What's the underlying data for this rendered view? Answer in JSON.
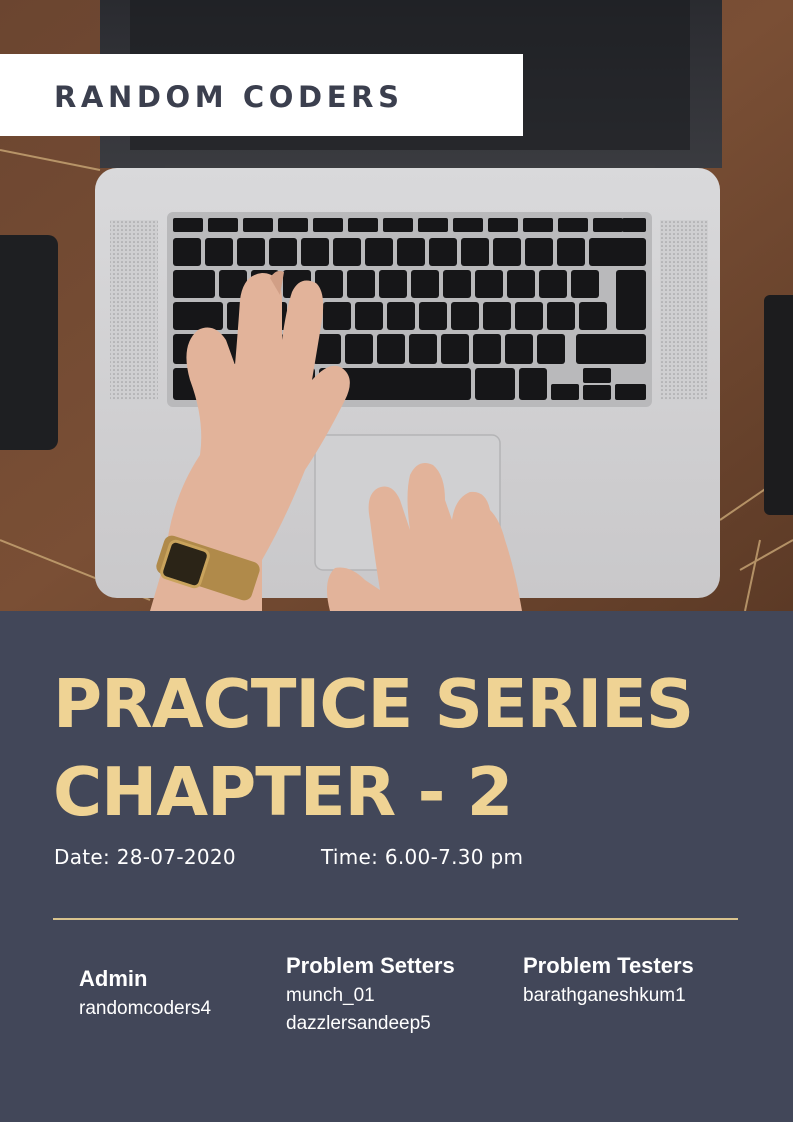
{
  "brand": {
    "name": "RANDOM CODERS"
  },
  "photo": {
    "subject": "hands-typing-on-laptop"
  },
  "title": {
    "line1": "PRACTICE SERIES",
    "line2": "CHAPTER - 2"
  },
  "event": {
    "date": "Date: 28-07-2020",
    "time": "Time: 6.00-7.30 pm"
  },
  "credits": {
    "admin": {
      "heading": "Admin",
      "names": [
        "randomcoders4"
      ]
    },
    "setters": {
      "heading": "Problem Setters",
      "names": [
        "munch_01",
        "dazzlersandeep5"
      ]
    },
    "testers": {
      "heading": "Problem Testers",
      "names": [
        "barathganeshkum1"
      ]
    }
  },
  "colors": {
    "panel": "#424759",
    "accent": "#efd394",
    "brand_text": "#3b3f4e"
  }
}
